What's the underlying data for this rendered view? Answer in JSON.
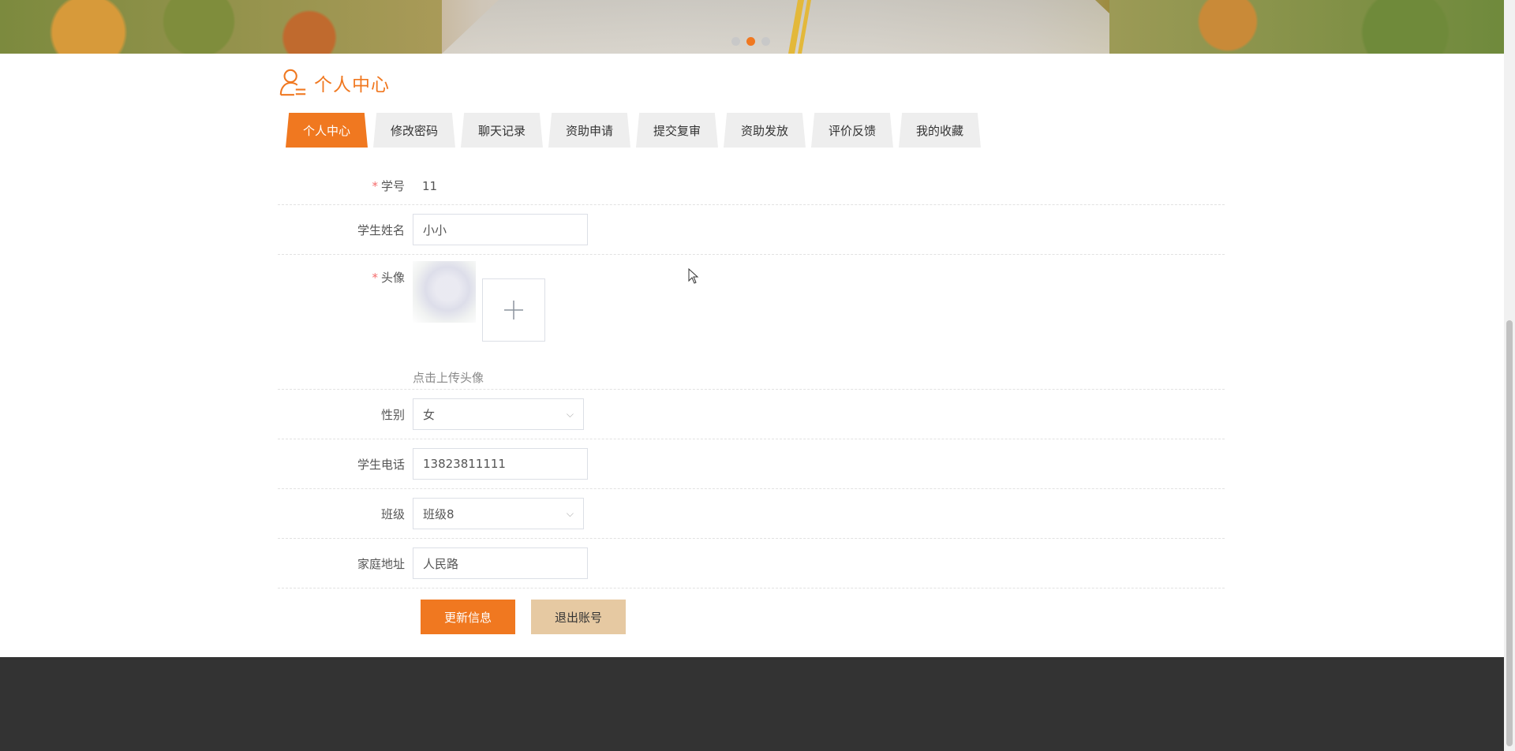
{
  "banner": {
    "carousel_dots": [
      false,
      true,
      false
    ]
  },
  "header": {
    "title": "个人中心",
    "icon": "user-icon",
    "accent_color": "#f07820"
  },
  "tabs": [
    {
      "label": "个人中心",
      "active": true
    },
    {
      "label": "修改密码",
      "active": false
    },
    {
      "label": "聊天记录",
      "active": false
    },
    {
      "label": "资助申请",
      "active": false
    },
    {
      "label": "提交复审",
      "active": false
    },
    {
      "label": "资助发放",
      "active": false
    },
    {
      "label": "评价反馈",
      "active": false
    },
    {
      "label": "我的收藏",
      "active": false
    }
  ],
  "form": {
    "student_id": {
      "label": "学号",
      "required": true,
      "value": "11"
    },
    "student_name": {
      "label": "学生姓名",
      "value": "小小"
    },
    "avatar": {
      "label": "头像",
      "required": true,
      "upload_icon": "plus-icon",
      "tip": "点击上传头像"
    },
    "gender": {
      "label": "性别",
      "value": "女"
    },
    "phone": {
      "label": "学生电话",
      "value": "13823811111"
    },
    "class": {
      "label": "班级",
      "value": "班级8"
    },
    "address": {
      "label": "家庭地址",
      "value": "人民路"
    }
  },
  "actions": {
    "update_label": "更新信息",
    "logout_label": "退出账号"
  }
}
